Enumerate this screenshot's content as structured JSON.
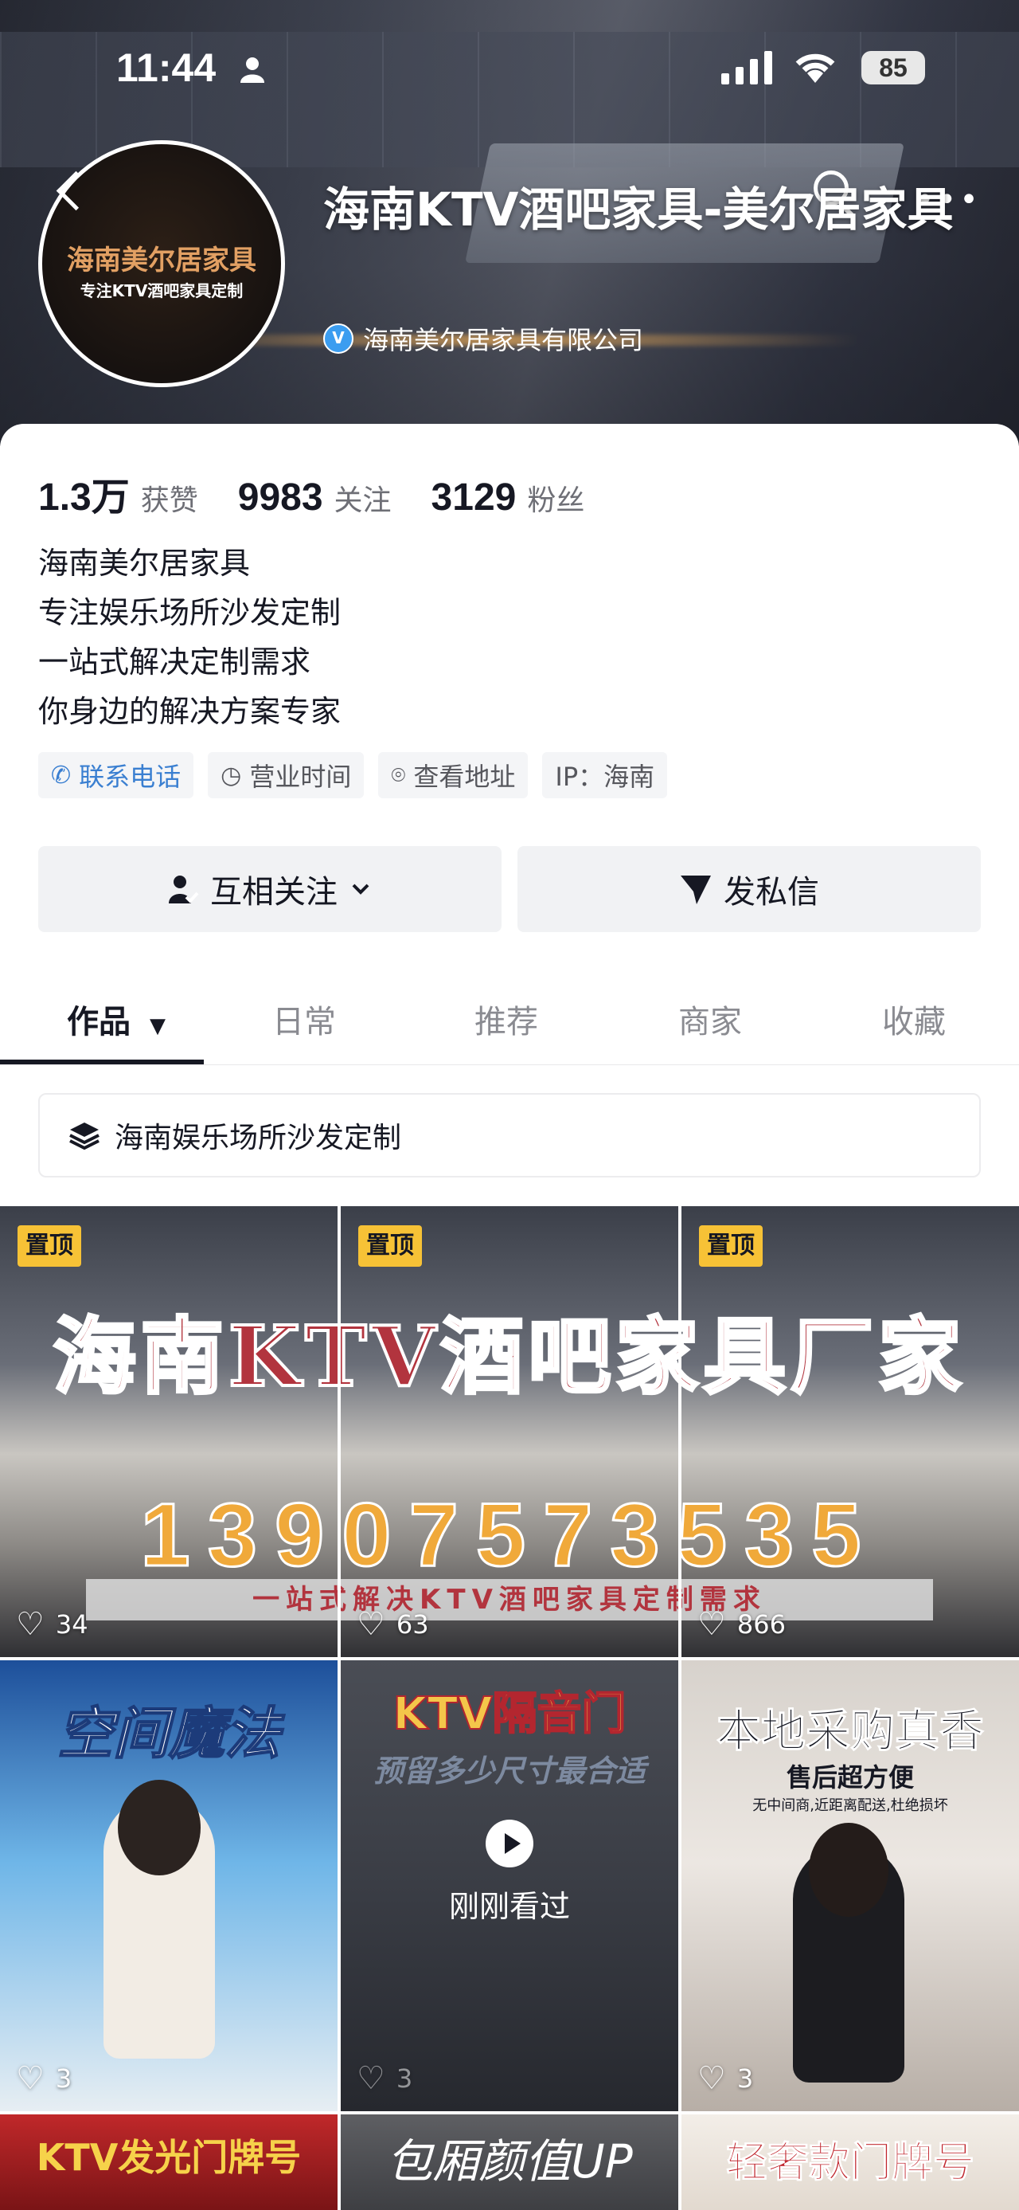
{
  "status_bar": {
    "time": "11:44",
    "battery": "85"
  },
  "header": {
    "avatar_line1": "海南美尔居家具",
    "avatar_line2": "专注KTV酒吧家具定制",
    "title": "海南KTV酒吧家具-美尔居家具",
    "verified_company": "海南美尔居家具有限公司"
  },
  "stats": [
    {
      "value": "1.3万",
      "label": "获赞"
    },
    {
      "value": "9983",
      "label": "关注"
    },
    {
      "value": "3129",
      "label": "粉丝"
    }
  ],
  "bio": [
    "海南美尔居家具",
    "专注娱乐场所沙发定制",
    "一站式解决定制需求",
    "你身边的解决方案专家"
  ],
  "tags": [
    {
      "label": "联系电话",
      "icon": "phone-icon"
    },
    {
      "label": "营业时间",
      "icon": "clock-icon"
    },
    {
      "label": "查看地址",
      "icon": "location-pin-icon"
    },
    {
      "label": "IP：海南",
      "icon": ""
    }
  ],
  "actions": {
    "follow": "互相关注",
    "message": "发私信"
  },
  "tabs": [
    "作品",
    "日常",
    "推荐",
    "商家",
    "收藏"
  ],
  "collection": "海南娱乐场所沙发定制",
  "pinned_label": "置顶",
  "pinned_banner": {
    "title": "海南KTV酒吧家具厂家",
    "phone": "13907573535",
    "subtitle": "一站式解决KTV酒吧家具定制需求"
  },
  "pinned_likes": [
    "34",
    "63",
    "866"
  ],
  "videos_row2": [
    {
      "title": "空间魔法",
      "likes": "3"
    },
    {
      "title": "KTV隔音门",
      "subtitle": "预留多少尺寸最合适",
      "likes": "3",
      "watched": "刚刚看过"
    },
    {
      "title": "本地采购真香",
      "subtitle": "售后超方便",
      "note": "无中间商,近距离配送,杜绝损坏",
      "likes": "3"
    }
  ],
  "videos_row3": [
    {
      "title": "KTV发光门牌号"
    },
    {
      "title": "包厢颜值UP"
    },
    {
      "title": "轻奢款门牌号"
    }
  ],
  "colors": {
    "accent_blue": "#3a7fd1",
    "pin_yellow": "#f7c236",
    "banner_red": "#b2343e",
    "phone_gold": "#f0a93a"
  }
}
